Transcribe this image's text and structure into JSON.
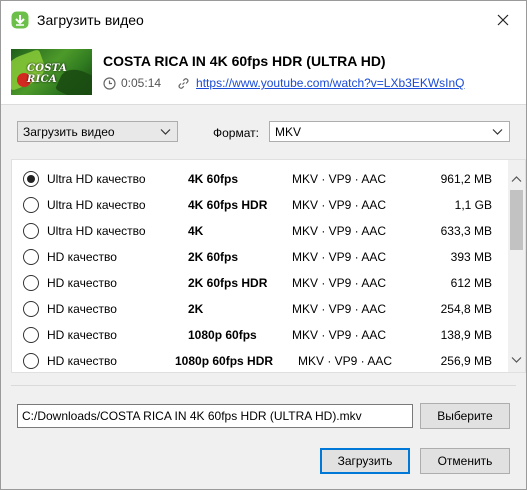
{
  "window": {
    "title": "Загрузить видео"
  },
  "video": {
    "title": "COSTA RICA IN 4K 60fps HDR (ULTRA HD)",
    "thumbnail_text": "COSTA RICA",
    "duration": "0:05:14",
    "url": "https://www.youtube.com/watch?v=LXb3EKWsInQ"
  },
  "controls": {
    "action_select": "Загрузить видео",
    "format_label": "Формат:",
    "format_select": "MKV"
  },
  "formats": [
    {
      "quality": "Ultra HD качество",
      "resolution": "4K 60fps",
      "codec": "MKV · VP9 · AAC",
      "size": "961,2 MB",
      "selected": true
    },
    {
      "quality": "Ultra HD качество",
      "resolution": "4K 60fps HDR",
      "codec": "MKV · VP9 · AAC",
      "size": "1,1 GB",
      "selected": false
    },
    {
      "quality": "Ultra HD качество",
      "resolution": "4K",
      "codec": "MKV · VP9 · AAC",
      "size": "633,3 MB",
      "selected": false
    },
    {
      "quality": "HD качество",
      "resolution": "2K 60fps",
      "codec": "MKV · VP9 · AAC",
      "size": "393 MB",
      "selected": false
    },
    {
      "quality": "HD качество",
      "resolution": "2K 60fps HDR",
      "codec": "MKV · VP9 · AAC",
      "size": "612 MB",
      "selected": false
    },
    {
      "quality": "HD качество",
      "resolution": "2K",
      "codec": "MKV · VP9 · AAC",
      "size": "254,8 MB",
      "selected": false
    },
    {
      "quality": "HD качество",
      "resolution": "1080p 60fps",
      "codec": "MKV · VP9 · AAC",
      "size": "138,9 MB",
      "selected": false
    },
    {
      "quality": "HD качество",
      "resolution": "1080p 60fps HDR",
      "codec": "MKV · VP9 · AAC",
      "size": "256,9 MB",
      "selected": false
    }
  ],
  "save": {
    "path": "C:/Downloads/COSTA RICA IN 4K 60fps HDR (ULTRA HD).mkv",
    "browse_label": "Выберите"
  },
  "footer": {
    "download_label": "Загрузить",
    "cancel_label": "Отменить"
  },
  "icons": {
    "app": "app-download-icon",
    "close": "close-icon",
    "clock": "clock-icon",
    "link": "link-icon",
    "chevron": "chevron-down-icon"
  },
  "colors": {
    "accent": "#0078d7",
    "link": "#1a4bd6",
    "app_icon": "#6cc04a"
  }
}
